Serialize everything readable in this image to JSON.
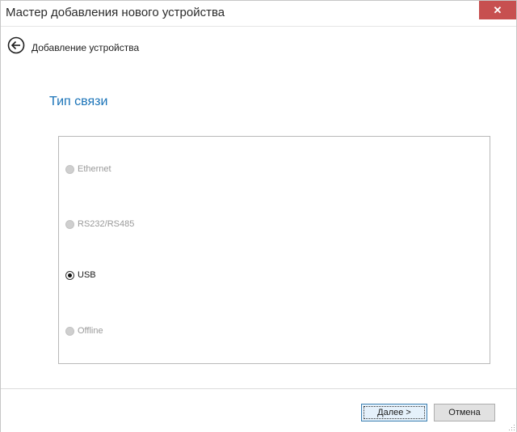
{
  "window": {
    "title": "Мастер добавления нового устройства",
    "close_glyph": "✕"
  },
  "nav": {
    "title": "Добавление устройства",
    "back_icon": "arrow-left-circle-icon"
  },
  "content": {
    "heading": "Тип связи",
    "options": [
      {
        "label": "Ethernet",
        "enabled": false,
        "checked": false
      },
      {
        "label": "RS232/RS485",
        "enabled": false,
        "checked": false
      },
      {
        "label": "USB",
        "enabled": true,
        "checked": true
      },
      {
        "label": "Offline",
        "enabled": false,
        "checked": false
      }
    ]
  },
  "footer": {
    "next_accel": "Д",
    "next_rest": "алее >",
    "cancel_label": "Отмена"
  },
  "colors": {
    "accent": "#1a73b8",
    "close_button": "#c75050"
  }
}
